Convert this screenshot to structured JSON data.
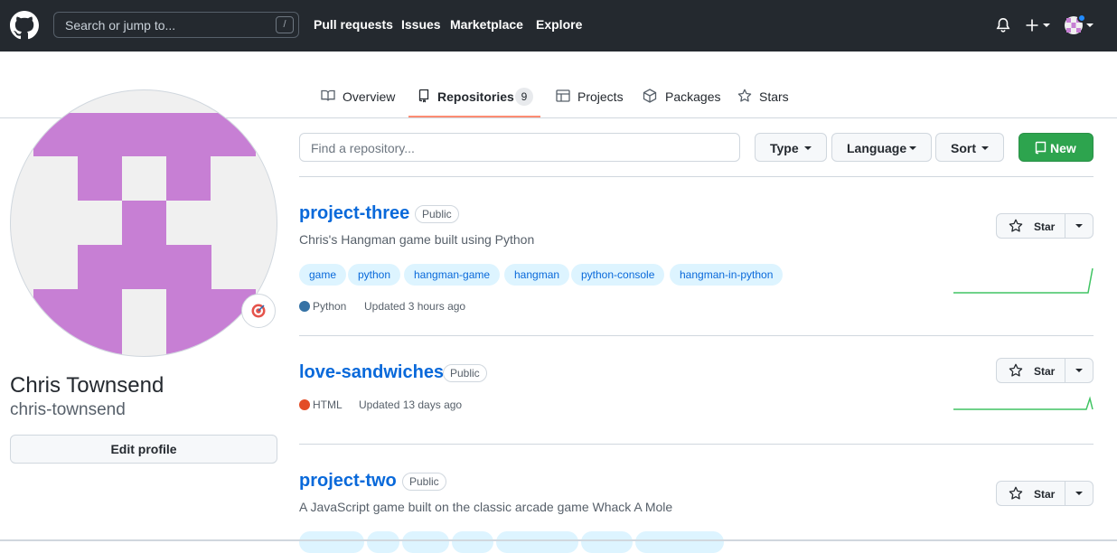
{
  "header": {
    "search_placeholder": "Search or jump to...",
    "search_shortcut": "/",
    "nav": [
      "Pull requests",
      "Issues",
      "Marketplace",
      "Explore"
    ],
    "icons": [
      "github-logo-icon",
      "bell-icon",
      "plus-icon",
      "avatar-icon"
    ]
  },
  "tabs": [
    {
      "label": "Overview",
      "icon": "book-icon"
    },
    {
      "label": "Repositories",
      "icon": "repo-icon",
      "count": "9",
      "active": true
    },
    {
      "label": "Projects",
      "icon": "table-icon"
    },
    {
      "label": "Packages",
      "icon": "package-icon"
    },
    {
      "label": "Stars",
      "icon": "star-icon"
    }
  ],
  "profile": {
    "full_name": "Chris Townsend",
    "username": "chris-townsend",
    "edit_label": "Edit profile",
    "status_icon": "dart-target-icon"
  },
  "filters": {
    "find_placeholder": "Find a repository...",
    "type_label": "Type",
    "language_label": "Language",
    "sort_label": "Sort",
    "new_label": "New"
  },
  "repos": [
    {
      "name": "project-three",
      "visibility": "Public",
      "description": "Chris's Hangman game built using Python",
      "topics": [
        "game",
        "python",
        "hangman-game",
        "hangman",
        "python-console",
        "hangman-in-python"
      ],
      "language": "Python",
      "language_color": "#3572A5",
      "updated": "Updated 3 hours ago",
      "star_label": "Star"
    },
    {
      "name": "love-sandwiches",
      "visibility": "Public",
      "language": "HTML",
      "language_color": "#e34c26",
      "updated": "Updated 13 days ago",
      "star_label": "Star"
    },
    {
      "name": "project-two",
      "visibility": "Public",
      "description": "A JavaScript game built on the classic arcade game Whack A Mole",
      "star_label": "Star"
    }
  ],
  "colors": {
    "header_bg": "#24292f",
    "link_blue": "#0969da",
    "green_button": "#2da44e",
    "tab_underline": "#fd8c73",
    "avatar_purple": "#c77fd4"
  }
}
